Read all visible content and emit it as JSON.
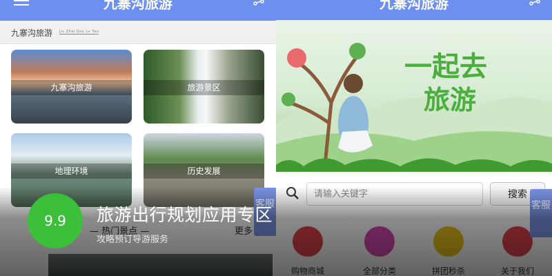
{
  "left_screen": {
    "app_title": "九寨沟旅游",
    "breadcrumb": {
      "main": "九寨沟旅游",
      "pinyin": "Jiu Zhai Gou Lv You"
    },
    "tiles": [
      {
        "label": "九寨沟旅游"
      },
      {
        "label": "旅游景区"
      },
      {
        "label": "地理环境"
      },
      {
        "label": "历史发展"
      }
    ],
    "hot_section": {
      "title": "—  热门景点  —",
      "more": "更多"
    },
    "service_tab": "客服"
  },
  "right_screen": {
    "app_title": "九寨沟旅游",
    "hero": {
      "line1": "一起去",
      "line2": "旅游"
    },
    "search": {
      "placeholder": "请输入关键字",
      "button": "搜索"
    },
    "icons": [
      {
        "label": "购物商城",
        "icon": "shop-icon",
        "color": "#e0444a"
      },
      {
        "label": "全部分类",
        "icon": "category-icon",
        "color": "#d44ab0"
      },
      {
        "label": "拼团秒杀",
        "icon": "new-badge-icon",
        "color": "#e8c21b"
      },
      {
        "label": "关于我们",
        "icon": "about-icon",
        "color": "#e0444a"
      }
    ],
    "service_tab": "客服"
  },
  "overlay": {
    "score": "9.9",
    "title": "旅游出行规划应用专区",
    "subtitle": "攻略预订导游服务"
  }
}
